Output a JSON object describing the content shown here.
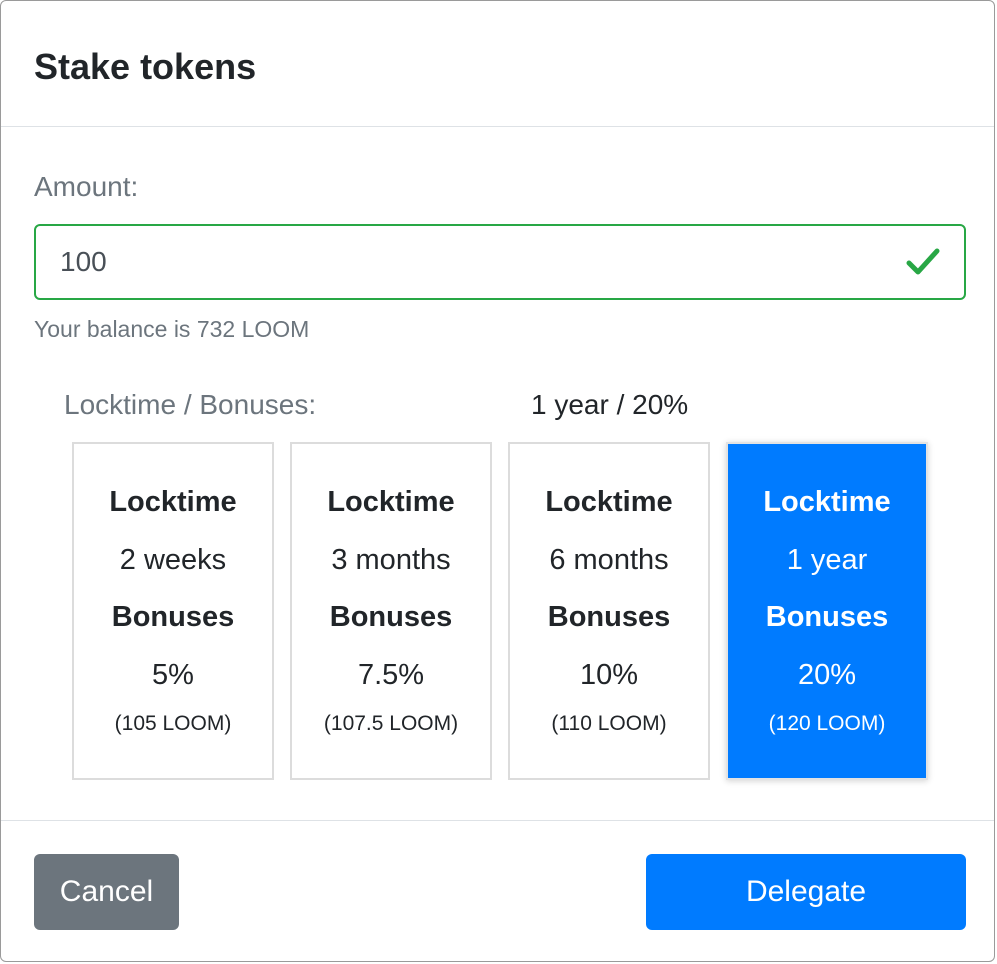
{
  "modal": {
    "title": "Stake tokens"
  },
  "amount": {
    "label": "Amount:",
    "value": "100",
    "valid_icon": "check-icon",
    "balance_text": "Your balance is 732 LOOM"
  },
  "locktime": {
    "label": "Locktime / Bonuses:",
    "selected_summary": "1 year / 20%",
    "options": [
      {
        "locktime_heading": "Locktime",
        "locktime": "2 weeks",
        "bonuses_heading": "Bonuses",
        "bonus": "5%",
        "bonus_amount": "(105 LOOM)",
        "selected": false
      },
      {
        "locktime_heading": "Locktime",
        "locktime": "3 months",
        "bonuses_heading": "Bonuses",
        "bonus": "7.5%",
        "bonus_amount": "(107.5 LOOM)",
        "selected": false
      },
      {
        "locktime_heading": "Locktime",
        "locktime": "6 months",
        "bonuses_heading": "Bonuses",
        "bonus": "10%",
        "bonus_amount": "(110 LOOM)",
        "selected": false
      },
      {
        "locktime_heading": "Locktime",
        "locktime": "1 year",
        "bonuses_heading": "Bonuses",
        "bonus": "20%",
        "bonus_amount": "(120 LOOM)",
        "selected": true
      }
    ]
  },
  "footer": {
    "cancel_label": "Cancel",
    "delegate_label": "Delegate"
  },
  "colors": {
    "primary": "#007bff",
    "secondary": "#6c757d",
    "success": "#28a745"
  }
}
